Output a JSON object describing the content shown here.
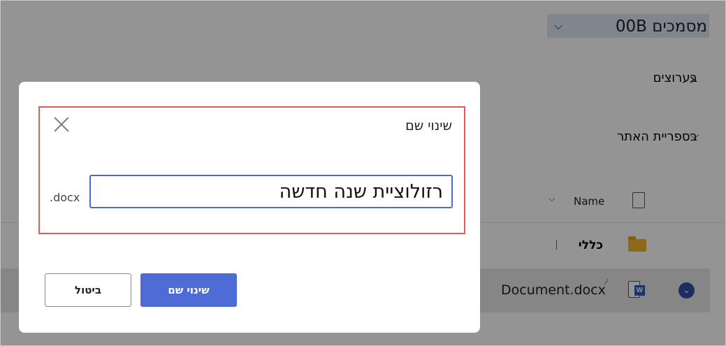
{
  "library": {
    "title": "מסמכים 00B",
    "chevron": "⌵"
  },
  "nav": {
    "items": [
      {
        "label": "בערוצים",
        "chevron": "›"
      },
      {
        "label": "בספריית האתר",
        "chevron": "⌵"
      }
    ]
  },
  "list": {
    "column_name": "Name",
    "sort_icon": "⌵",
    "rows": [
      {
        "label": "כללי",
        "icon": "folder-icon"
      },
      {
        "label": "Document.docx",
        "icon": "word-icon",
        "selected": true
      }
    ]
  },
  "dialog": {
    "title": "שינוי שם",
    "input_value": "רזולוציית שנה חדשה",
    "extension": ".docx",
    "primary_label": "שינוי שם",
    "secondary_label": "ביטול"
  },
  "colors": {
    "accent": "#4e6bd6",
    "highlight": "#e25b5b",
    "selection": "#e7e7e7"
  }
}
